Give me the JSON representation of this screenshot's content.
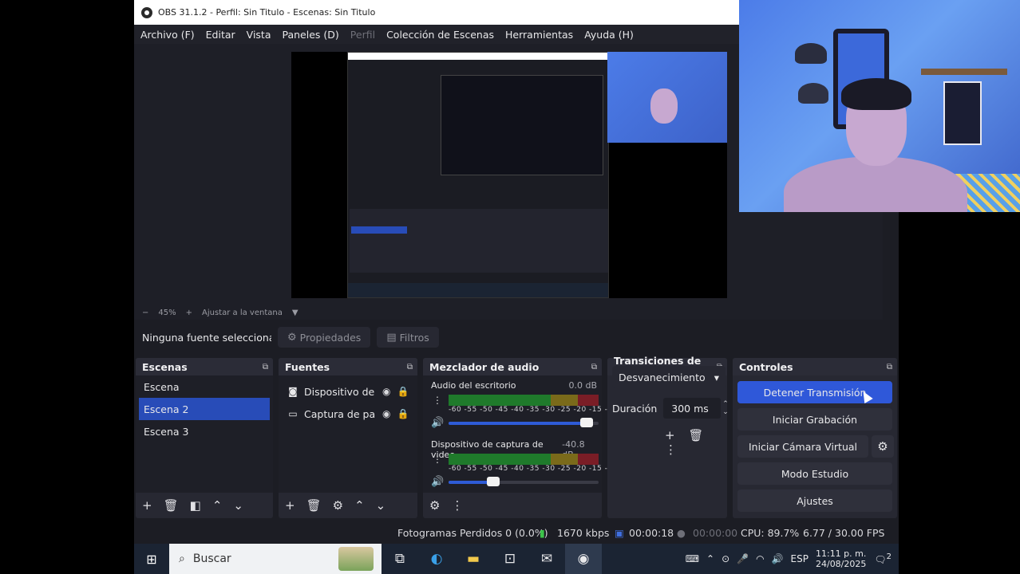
{
  "window": {
    "title": "OBS 31.1.2 - Perfil: Sin Titulo - Escenas: Sin Titulo"
  },
  "menu": [
    {
      "label": "Archivo (F)",
      "enabled": true
    },
    {
      "label": "Editar",
      "enabled": true
    },
    {
      "label": "Vista",
      "enabled": true
    },
    {
      "label": "Paneles (D)",
      "enabled": true
    },
    {
      "label": "Perfil",
      "enabled": false
    },
    {
      "label": "Colección de Escenas",
      "enabled": true
    },
    {
      "label": "Herramientas",
      "enabled": true
    },
    {
      "label": "Ayuda (H)",
      "enabled": true
    }
  ],
  "zoom": {
    "minus": "−",
    "level": "45%",
    "plus": "+",
    "fit_label": "Ajustar a la ventana",
    "dropdown": "▼"
  },
  "source_toolbar": {
    "no_selection": "Ninguna fuente seleccionada",
    "properties": "Propiedades",
    "filters": "Filtros"
  },
  "scenes": {
    "title": "Escenas",
    "items": [
      "Escena",
      "Escena 2",
      "Escena 3"
    ],
    "selected_index": 1
  },
  "sources": {
    "title": "Fuentes",
    "items": [
      {
        "name": "Dispositivo de captura de video",
        "icon": "camera-icon"
      },
      {
        "name": "Captura de pantalla",
        "icon": "monitor-icon"
      }
    ]
  },
  "mixer": {
    "title": "Mezclador de audio",
    "channels": [
      {
        "name": "Audio del escritorio",
        "db": "0.0 dB",
        "volume_fraction": 0.92
      },
      {
        "name": "Dispositivo de captura de video",
        "db": "-40.8 dB",
        "volume_fraction": 0.3
      }
    ],
    "scale": "-60 -55 -50 -45 -40 -35 -30 -25 -20 -15 -10 -5 0"
  },
  "transitions": {
    "title": "Transiciones de e...",
    "selected": "Desvanecimiento",
    "duration_label": "Duración",
    "duration_value": "300 ms"
  },
  "controls": {
    "title": "Controles",
    "buttons": [
      "Detener Transmisión",
      "Iniciar Grabación",
      "Iniciar Cámara Virtual",
      "Modo Estudio",
      "Ajustes"
    ]
  },
  "status": {
    "dropped": "Fotogramas Perdidos 0 (0.0%)",
    "bitrate": "1670 kbps",
    "stream_time": "00:00:18",
    "rec_time": "00:00:00",
    "cpu": "CPU: 89.7%",
    "fps": "6.77 / 30.00 FPS"
  },
  "taskbar": {
    "search_placeholder": "Buscar",
    "lang": "ESP",
    "time": "11:11 p. m.",
    "date": "24/08/2025",
    "notifications": "2"
  },
  "colors": {
    "accent": "#2f58d9",
    "panel": "#272832",
    "background": "#1c1d24"
  }
}
